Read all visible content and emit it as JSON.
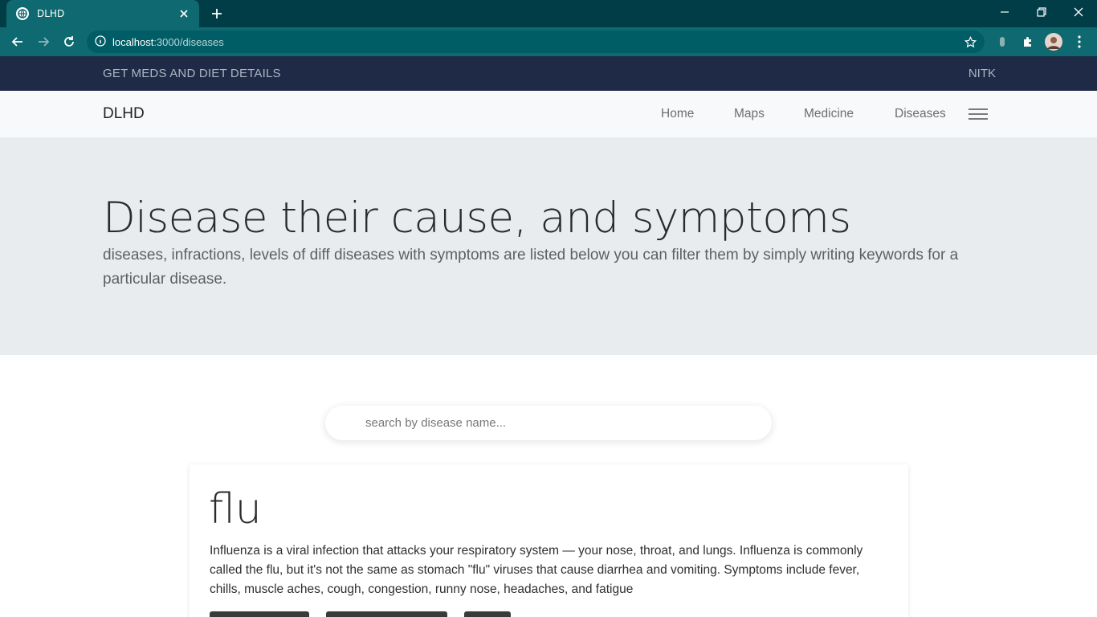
{
  "browser": {
    "tab_title": "DLHD",
    "url_host": "localhost",
    "url_path": ":3000/diseases",
    "colors": {
      "tabstrip": "#003d46",
      "toolbar": "#0f6970"
    }
  },
  "topbar": {
    "left_text": "GET MEDS AND DIET DETAILS",
    "right_text": "NITK"
  },
  "navbar": {
    "brand": "DLHD",
    "links": [
      "Home",
      "Maps",
      "Medicine",
      "Diseases"
    ]
  },
  "hero": {
    "title": "Disease their cause, and symptoms",
    "lead": "diseases, infractions, levels of diff diseases with symptoms are listed below you can filter them by simply writing keywords for a particular disease."
  },
  "search": {
    "placeholder": "search by disease name...",
    "value": ""
  },
  "disease_card": {
    "title": "flu",
    "description": "Influenza is a viral infection that attacks your respiratory system — your nose, throat, and lungs. Influenza is commonly called the flu, but it's not the same as stomach \"flu\" viruses that cause diarrhea and vomiting. Symptoms include fever, chills, muscle aches, cough, congestion, runny nose, headaches, and fatigue"
  }
}
